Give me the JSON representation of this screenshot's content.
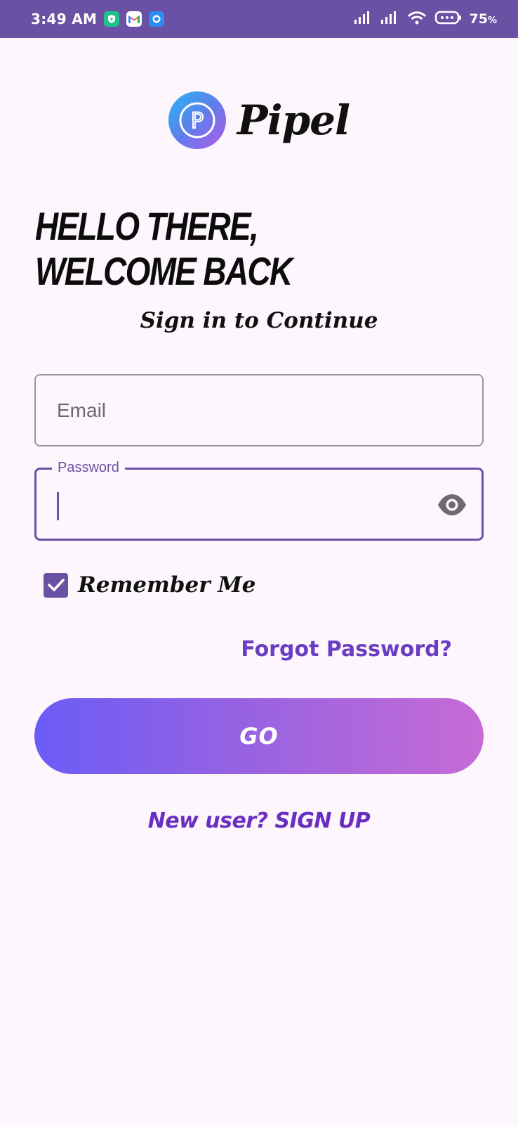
{
  "status_bar": {
    "time": "3:49 AM",
    "battery": "75",
    "battery_unit": "%",
    "icons": [
      "vpn-shield-icon",
      "gmail-icon",
      "messenger-icon",
      "signal-icon",
      "signal-icon",
      "wifi-icon",
      "battery-icon"
    ]
  },
  "app": {
    "logo_letter": "P",
    "name": "Pipel"
  },
  "headline": {
    "line1": "HELLO THERE,",
    "line2": "WELCOME BACK"
  },
  "subtitle": "Sign in to Continue",
  "form": {
    "email_placeholder": "Email",
    "password_label": "Password",
    "remember_label": "Remember Me",
    "remember_checked": true,
    "forgot_link": "Forgot Password?",
    "submit_label": "GO",
    "signup_link": "New user? SIGN UP"
  },
  "colors": {
    "primary": "#6a51a3",
    "link": "#6a3ec3",
    "background": "#fdf7fd"
  }
}
